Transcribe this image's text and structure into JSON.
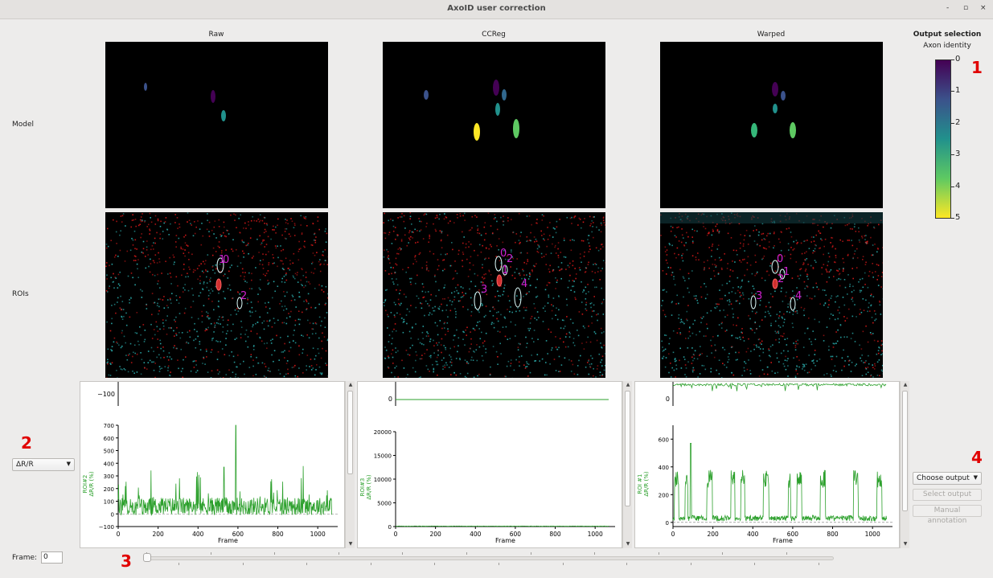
{
  "window": {
    "title": "AxoID user correction",
    "minimize": "-",
    "maximize": "▫",
    "close": "×"
  },
  "columns": [
    "Raw",
    "CCReg",
    "Warped"
  ],
  "rows": {
    "model": "Model",
    "rois": "ROIs"
  },
  "output_selection": {
    "title": "Output selection",
    "subtitle": "Axon identity",
    "colorbar_ticks": [
      "0",
      "1",
      "2",
      "3",
      "4",
      "5"
    ],
    "colorbar_colors": [
      "#440154",
      "#3b528b",
      "#21918c",
      "#5ec962",
      "#fde725"
    ]
  },
  "annotations": [
    "1",
    "2",
    "3",
    "4"
  ],
  "roi_labels": {
    "raw": [
      "0",
      "1",
      "2"
    ],
    "ccreg": [
      "0",
      "2",
      "1",
      "3",
      "4"
    ],
    "warped": [
      "0",
      "1",
      "2",
      "3",
      "4"
    ]
  },
  "plots": [
    {
      "top_ticks": [
        "−100"
      ],
      "ylabel": "ROI#2\nΔR/R (%)",
      "yticks": [
        "700",
        "600",
        "500",
        "400",
        "300",
        "200",
        "100",
        "0",
        "−100"
      ],
      "xticks": [
        "0",
        "200",
        "400",
        "600",
        "800",
        "1000"
      ],
      "xlabel": "Frame"
    },
    {
      "top_ticks": [
        "0"
      ],
      "ylabel": "ROI#3\nΔR/R (%)",
      "yticks": [
        "20000",
        "15000",
        "10000",
        "5000",
        "0"
      ],
      "xticks": [
        "0",
        "200",
        "400",
        "600",
        "800",
        "1000"
      ],
      "xlabel": "Frame"
    },
    {
      "top_ticks": [
        "0"
      ],
      "ylabel": "ROI #1\nΔR/R (%)",
      "yticks": [
        "600",
        "400",
        "200",
        "0"
      ],
      "xticks": [
        "0",
        "200",
        "400",
        "600",
        "800",
        "1000"
      ],
      "xlabel": "Frame"
    }
  ],
  "controls": {
    "signal_type": "ΔR/R",
    "frame_label": "Frame:",
    "frame_value": "0",
    "choose_output": "Choose output",
    "select_output": "Select output",
    "manual_annotation": "Manual annotation"
  },
  "colors": {
    "trace": "#2ca02c",
    "roi_label": "#d020d0",
    "accent_red": "#e10000"
  }
}
